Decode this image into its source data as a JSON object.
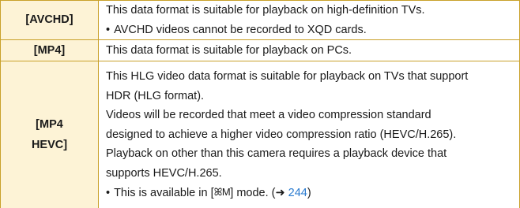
{
  "colors": {
    "border": "#c9a12a",
    "label_bg": "#fdf3d6",
    "link": "#2a7bd0"
  },
  "rows": [
    {
      "label": "[AVCHD]",
      "lines": [
        "This data format is suitable for playback on high-definition TVs.",
        "AVCHD videos cannot be recorded to XQD cards."
      ]
    },
    {
      "label": "[MP4]",
      "lines": [
        "This data format is suitable for playback on PCs."
      ]
    },
    {
      "label_line1": "[MP4",
      "label_line2": "HEVC]",
      "lines": [
        "This HLG video data format is suitable for playback on TVs that support",
        "HDR (HLG format).",
        "Videos will be recorded that meet a video compression standard",
        "designed to achieve a higher video compression ratio (HEVC/H.265).",
        "Playback on other than this camera requires a playback device that",
        "supports HEVC/H.265."
      ],
      "note_prefix": "This is available in [",
      "note_mode_icon": "ꕤM",
      "note_mode_icon_name": "creative-video-mode-icon",
      "note_suffix": "] mode. (",
      "note_arrow": "➜",
      "note_page": "244",
      "note_close": ")"
    }
  ]
}
